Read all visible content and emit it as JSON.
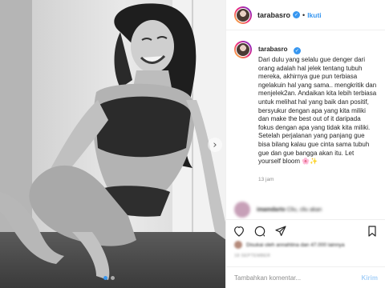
{
  "post": {
    "image_alt": "Black and white photo of a smiling woman in a sports bra sitting on a floor by a window",
    "carousel_dots": 2
  },
  "header": {
    "username": "tarabasro",
    "separator": "•",
    "follow_label": "Ikuti"
  },
  "caption": {
    "username": "tarabasro",
    "text": "Dari dulu yang selalu gue denger dari orang adalah hal jelek tentang tubuh mereka, akhirnya gue pun terbiasa ngelakuin hal yang sama.. mengkritik dan menjelek2an. Andaikan kita lebih terbiasa untuk melihat hal yang baik dan positif, bersyukur dengan apa yang kita miliki dan make the best out of it daripada fokus dengan apa yang tidak kita miliki. Setelah perjalanan yang panjang gue bisa bilang kalau gue cinta sama tubuh gue dan gue bangga akan itu. Let yourself bloom",
    "emoji": "🌸✨",
    "timestamp": "13 jam"
  },
  "blurred_comment": {
    "username": "imamdarto",
    "text": "Cliu, cliu akan"
  },
  "likes": {
    "text": "Disukai oleh annahtina dan 47.000 lainnya"
  },
  "date": "18 SEPTEMBER",
  "comment_form": {
    "placeholder": "Tambahkan komentar...",
    "post_label": "Kirim"
  },
  "colors": {
    "accent": "#3897f0",
    "text": "#262626",
    "muted": "#8e8e8e"
  },
  "icons": [
    "chevron-right-icon",
    "verified-badge-icon",
    "heart-icon",
    "comment-icon",
    "share-icon",
    "bookmark-icon"
  ]
}
